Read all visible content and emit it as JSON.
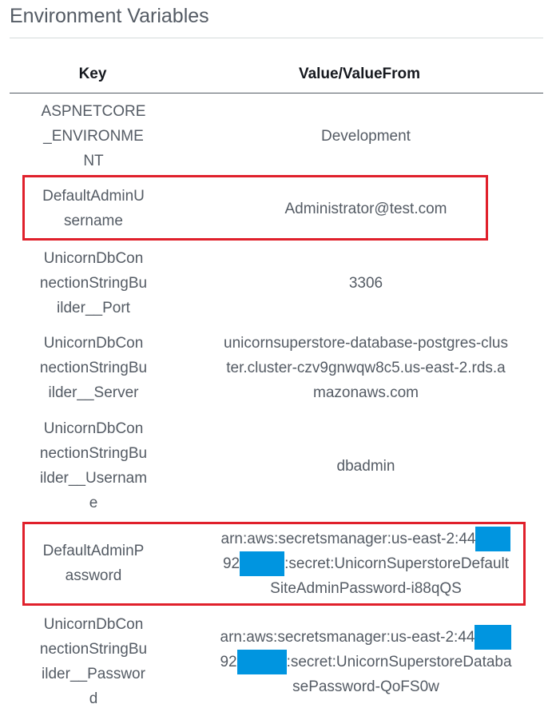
{
  "section": {
    "title": "Environment Variables"
  },
  "columns": {
    "key": "Key",
    "value": "Value/ValueFrom"
  },
  "rows": [
    {
      "key": [
        "ASPNETCORE",
        "_ENVIRONME",
        "NT"
      ],
      "value": [
        "Development"
      ]
    },
    {
      "key": [
        "DefaultAdminU",
        "sername"
      ],
      "value": [
        "Administrator@test.com"
      ]
    },
    {
      "key": [
        "UnicornDbCon",
        "nectionStringBu",
        "ilder__Port"
      ],
      "value": [
        "3306"
      ]
    },
    {
      "key": [
        "UnicornDbCon",
        "nectionStringBu",
        "ilder__Server"
      ],
      "value": [
        "unicornsuperstore-database-postgres-clus",
        "ter.cluster-czv9gnwqw8c5.us-east-2.rds.a",
        "mazonaws.com"
      ]
    },
    {
      "key": [
        "UnicornDbCon",
        "nectionStringBu",
        "ilder__Usernam",
        "e"
      ],
      "value": [
        "dbadmin"
      ]
    },
    {
      "key": [
        "DefaultAdminP",
        "assword"
      ],
      "value": [
        "arn:aws:secretsmanager:us-east-2:44",
        "92",
        ":secret:UnicornSuperstoreDefault",
        "SiteAdminPassword-i88qQS"
      ]
    },
    {
      "key": [
        "UnicornDbCon",
        "nectionStringBu",
        "ilder__Passwor",
        "d"
      ],
      "value": [
        "arn:aws:secretsmanager:us-east-2:44",
        "92",
        ":secret:UnicornSuperstoreDataba",
        "sePassword-QoFS0w"
      ]
    }
  ],
  "colors": {
    "highlight": "#e0202b",
    "redaction": "#0095e0",
    "text": "#545b64"
  }
}
